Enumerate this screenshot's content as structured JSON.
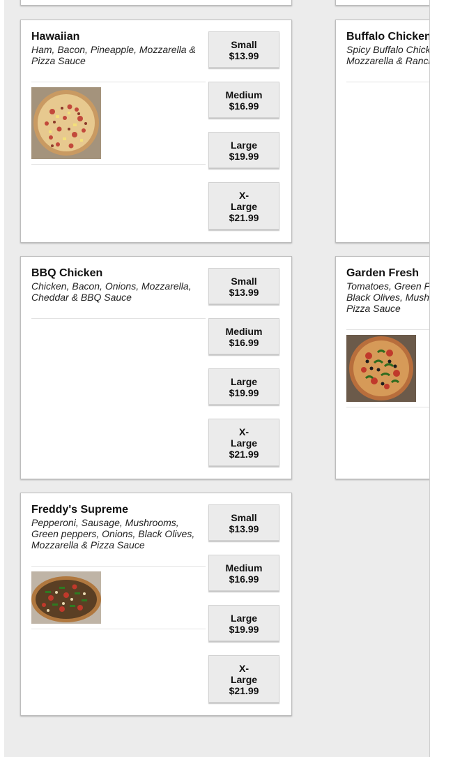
{
  "menu": {
    "pizzas": [
      {
        "name": "Hawaiian",
        "description": "Ham, Bacon, Pineapple, Mozzarella & Pizza Sauce",
        "image": "hawaiian-pizza-photo",
        "sizes": [
          {
            "size": "Small",
            "price": "$13.99"
          },
          {
            "size": "Medium",
            "price": "$16.99"
          },
          {
            "size": "Large",
            "price": "$19.99"
          },
          {
            "size": "X-Large",
            "price": "$21.99"
          }
        ]
      },
      {
        "name": "Buffalo Chicken",
        "description": "Spicy Buffalo Chick Mozzarella & Ranch"
      },
      {
        "name": "BBQ Chicken",
        "description": "Chicken, Bacon, Onions, Mozzarella, Cheddar & BBQ Sauce",
        "sizes": [
          {
            "size": "Small",
            "price": "$13.99"
          },
          {
            "size": "Medium",
            "price": "$16.99"
          },
          {
            "size": "Large",
            "price": "$19.99"
          },
          {
            "size": "X-Large",
            "price": "$21.99"
          }
        ]
      },
      {
        "name": "Garden Fresh",
        "description": "Tomatoes, Green P Black Olives, Mush Pizza Sauce",
        "image": "garden-fresh-pizza-photo"
      },
      {
        "name": "Freddy's Supreme",
        "description": "Pepperoni, Sausage, Mushrooms, Green peppers, Onions, Black Olives, Mozzarella & Pizza Sauce",
        "image": "supreme-pizza-photo",
        "sizes": [
          {
            "size": "Small",
            "price": "$13.99"
          },
          {
            "size": "Medium",
            "price": "$16.99"
          },
          {
            "size": "Large",
            "price": "$19.99"
          },
          {
            "size": "X-Large",
            "price": "$21.99"
          }
        ]
      }
    ]
  },
  "colors": {
    "background": "#ececec",
    "card": "#ffffff",
    "button": "#ebebeb",
    "text": "#111111"
  }
}
